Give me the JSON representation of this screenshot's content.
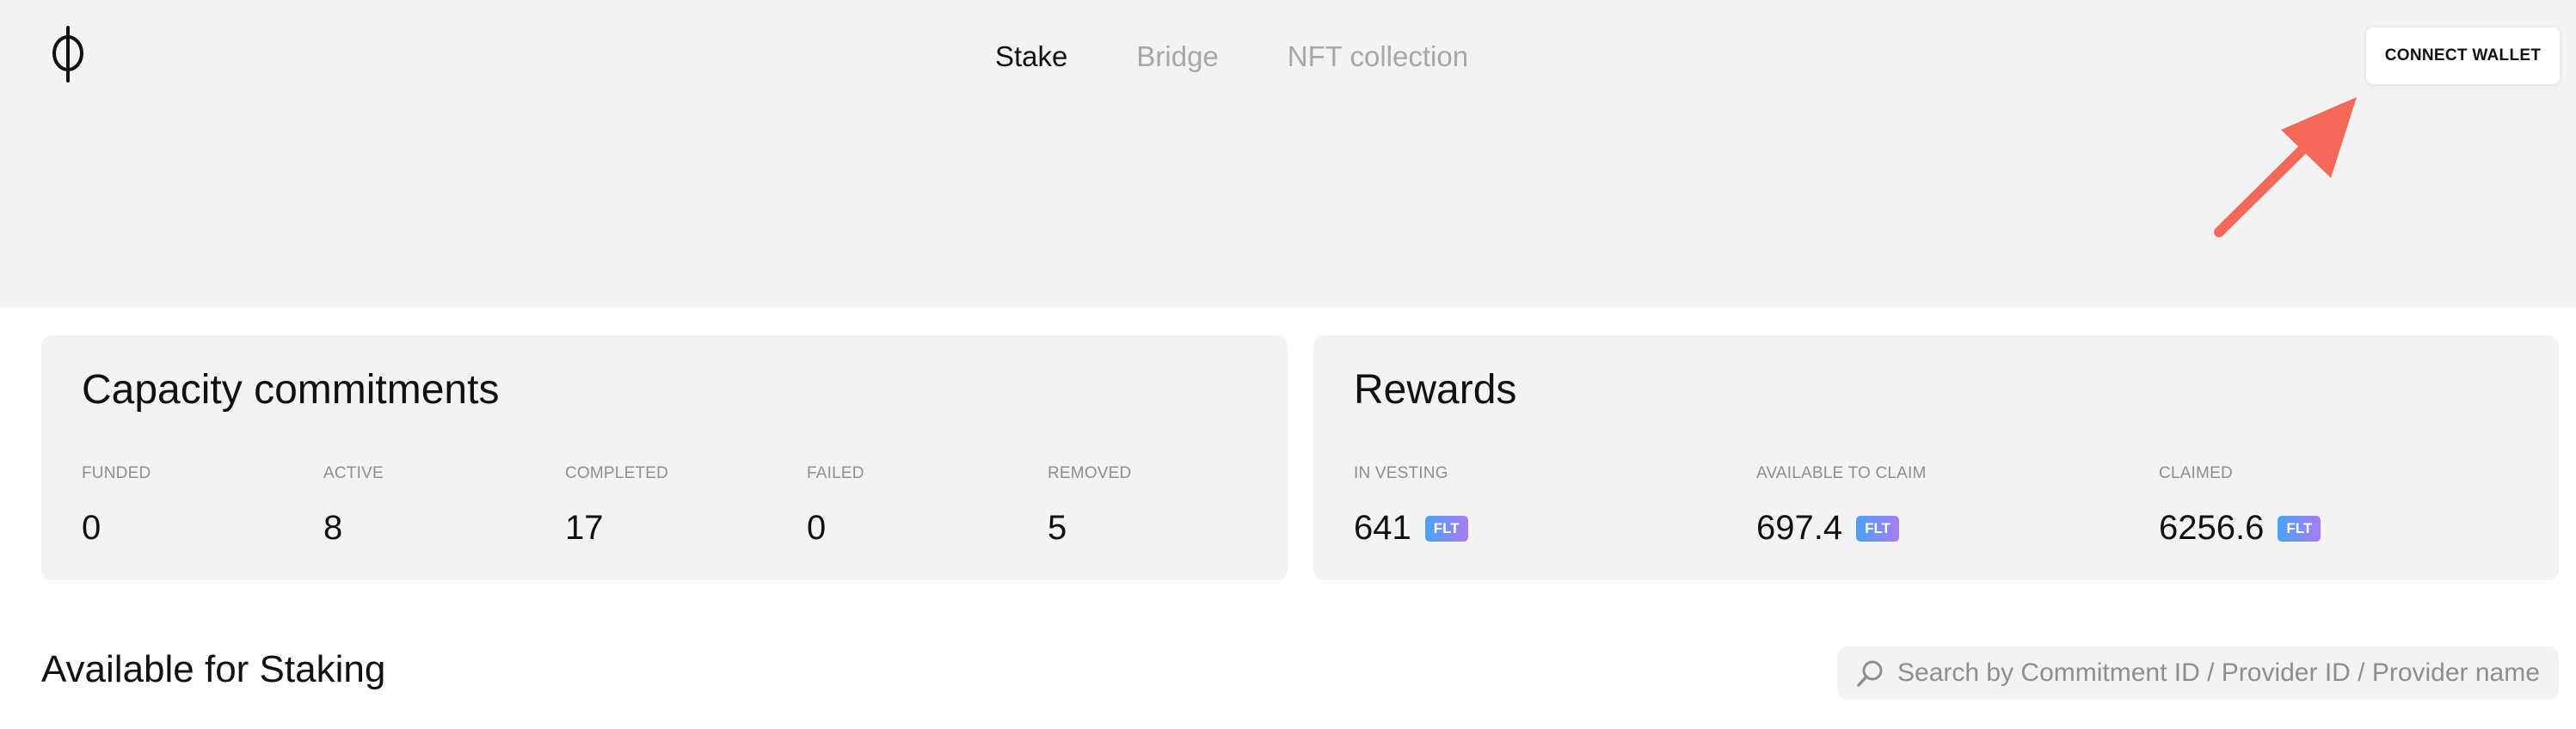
{
  "header": {
    "logo": {
      "icon": "phi-logo-icon",
      "glyph": "ϕ"
    },
    "nav": [
      {
        "label": "Stake",
        "active": true
      },
      {
        "label": "Bridge",
        "active": false
      },
      {
        "label": "NFT collection",
        "active": false
      }
    ],
    "connect_wallet_label": "CONNECT WALLET",
    "annotation": {
      "icon": "arrow-pointer-icon",
      "color": "#f5695a"
    }
  },
  "capacity": {
    "title": "Capacity commitments",
    "stats": [
      {
        "label": "FUNDED",
        "value": "0"
      },
      {
        "label": "ACTIVE",
        "value": "8"
      },
      {
        "label": "COMPLETED",
        "value": "17"
      },
      {
        "label": "FAILED",
        "value": "0"
      },
      {
        "label": "REMOVED",
        "value": "5"
      }
    ]
  },
  "rewards": {
    "title": "Rewards",
    "stats": [
      {
        "label": "IN VESTING",
        "value": "641",
        "unit": "FLT"
      },
      {
        "label": "AVAILABLE TO CLAIM",
        "value": "697.4",
        "unit": "FLT"
      },
      {
        "label": "CLAIMED",
        "value": "6256.6",
        "unit": "FLT"
      }
    ]
  },
  "staking": {
    "title": "Available for Staking",
    "search_placeholder": "Search by Commitment ID / Provider ID / Provider name"
  },
  "colors": {
    "header_bg": "#f3f3f3",
    "card_bg": "#f3f3f3",
    "nav_inactive": "#a7a7a7",
    "label_gray": "#8e8e8e",
    "badge_gradient_start": "#4aa2f5",
    "badge_gradient_end": "#a77cf2",
    "arrow": "#f5695a"
  }
}
